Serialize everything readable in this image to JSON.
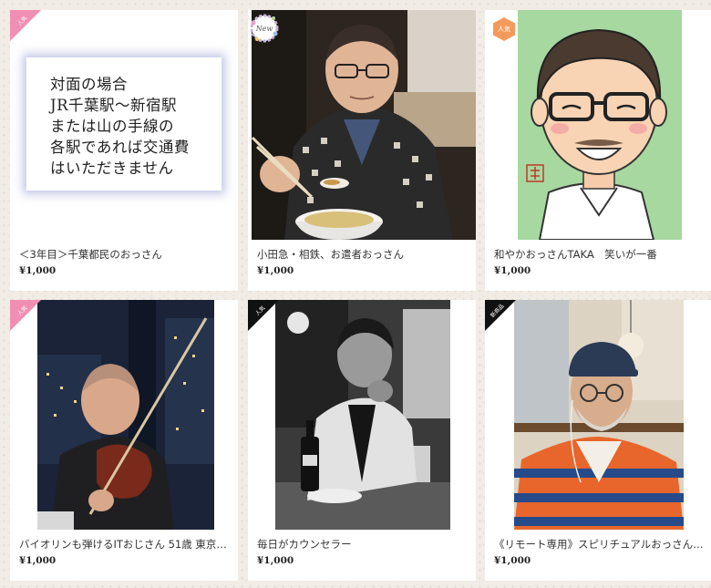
{
  "colors": {
    "ribbon_pink": "#f08fb2",
    "ribbon_black": "#111111",
    "badge_orange": "#f39a5c",
    "background": "#f1ece6"
  },
  "cards": [
    {
      "badge": {
        "type": "ribbon",
        "label": "人気",
        "color": "#f08fb2"
      },
      "notice_lines": [
        "対面の場合",
        "JR千葉駅〜新宿駅",
        "または山の手線の",
        "各駅であれば交通費",
        "はいただきません"
      ],
      "title": "＜3年目＞千葉都民のおっさん",
      "price": "¥1,000"
    },
    {
      "badge": {
        "type": "new",
        "label": "New"
      },
      "title": "小田急・相鉄、お遣者おっさん",
      "price": "¥1,000"
    },
    {
      "badge": {
        "type": "hex",
        "label": "人気",
        "color": "#f39a5c"
      },
      "title": "和やかおっさんTAKA　笑いが一番",
      "price": "¥1,000"
    },
    {
      "badge": {
        "type": "ribbon",
        "label": "人気",
        "color": "#f08fb2"
      },
      "title": "バイオリンも弾けるITおじさん 51歳 東京…",
      "price": "¥1,000"
    },
    {
      "badge": {
        "type": "ribbon",
        "label": "人気",
        "color": "#111111"
      },
      "title": "毎日がカウンセラー",
      "price": "¥1,000"
    },
    {
      "badge": {
        "type": "ribbon",
        "label": "新商品",
        "color": "#111111"
      },
      "title": "《リモート専用》スピリチュアルおっさん…",
      "price": "¥1,000"
    }
  ]
}
